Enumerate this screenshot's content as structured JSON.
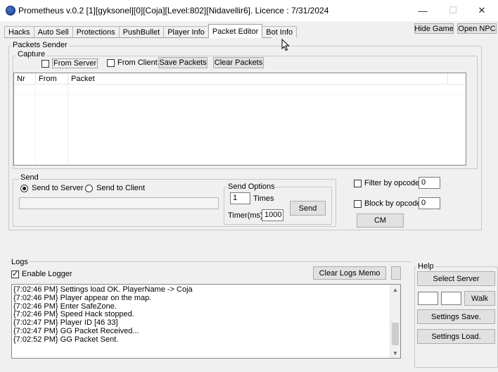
{
  "window": {
    "title": "Prometheus v.0.2 [1][gyksonel][0][Coja][Level:802][Nidavellir6]. Licence : 7/31/2024",
    "minimize_glyph": "—",
    "maximize_glyph": "☐",
    "close_glyph": "✕"
  },
  "tabs": [
    {
      "label": "Hacks"
    },
    {
      "label": "Auto Sell"
    },
    {
      "label": "Protections"
    },
    {
      "label": "PushBullet"
    },
    {
      "label": "Player Info"
    },
    {
      "label": "Packet Editor"
    },
    {
      "label": "Bot Info"
    }
  ],
  "top_buttons": {
    "hide_game": "Hide Game",
    "open_npc": "Open NPC"
  },
  "packets_sender": {
    "label": "Packets Sender",
    "capture": {
      "label": "Capture",
      "from_server": "From Server",
      "from_client": "From Client",
      "save_packets": "Save Packets",
      "clear_packets": "Clear Packets",
      "columns": [
        "Nr",
        "From",
        "Packet"
      ]
    },
    "send": {
      "label": "Send",
      "send_to_server": "Send to Server",
      "send_to_client": "Send to Client",
      "packet_value": ""
    },
    "send_options": {
      "label": "Send Options",
      "times_value": "1",
      "times_label": "Times",
      "timer_label": "Timer(ms):",
      "timer_value": "1000",
      "send_button": "Send"
    },
    "filter_by_opcode": {
      "label": "Filter by opcode",
      "value": "0"
    },
    "block_by_opcode": {
      "label": "Block by opcode",
      "value": "0"
    },
    "cm_button": "CM"
  },
  "logs": {
    "label": "Logs",
    "enable_logger": "Enable Logger",
    "clear_button": "Clear Logs Memo",
    "lines": [
      "{7:02:46 PM} Settings load OK. PlayerName -> Coja",
      "{7:02:46 PM} Player appear on the map.",
      "{7:02:46 PM} Enter SafeZone.",
      "{7:02:46 PM} Speed Hack stopped.",
      "{7:02:47 PM} Player ID [46 33]",
      "{7:02:47 PM} GG Packet Received...",
      "{7:02:52 PM} GG Packet Sent."
    ]
  },
  "help": {
    "label": "Help",
    "select_server": "Select Server",
    "walk": "Walk",
    "settings_save": "Settings Save.",
    "settings_load": "Settings Load."
  },
  "icons": {
    "app": "prometheus-icon",
    "cursor": "mouse-cursor-icon",
    "scroll_up": "▲",
    "scroll_down": "▼"
  }
}
